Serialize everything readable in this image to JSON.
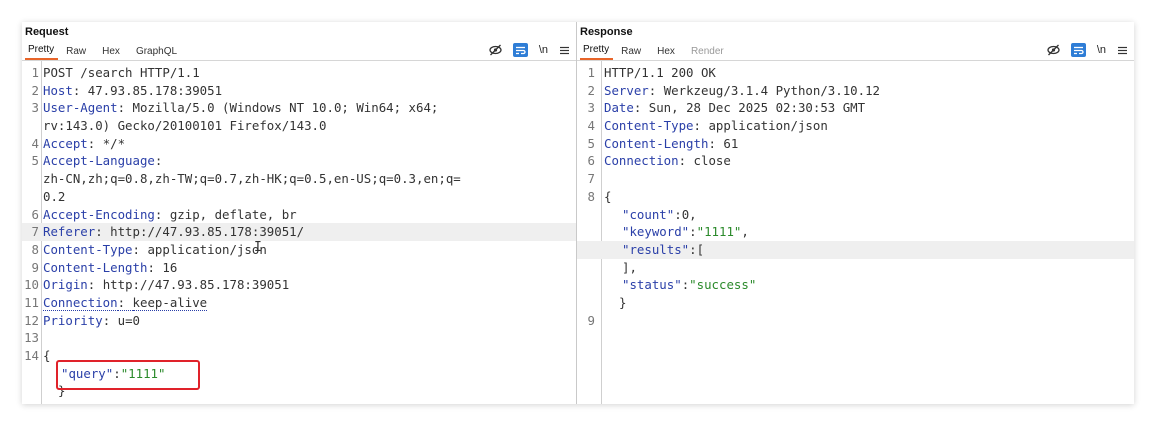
{
  "request": {
    "title": "Request",
    "tabs": [
      "Pretty",
      "Raw",
      "Hex",
      "GraphQL"
    ],
    "tools": {
      "hide_icon": "eye-slash-icon",
      "wrap_icon": "wrap-text-icon",
      "newline_label": "\\n",
      "menu_icon": "hamburger-menu-icon"
    },
    "lines": [
      {
        "n": "1",
        "name": "",
        "sep": "",
        "value": "POST /search HTTP/1.1"
      },
      {
        "n": "2",
        "name": "Host",
        "sep": ": ",
        "value": "47.93.85.178:39051"
      },
      {
        "n": "3",
        "name": "User-Agent",
        "sep": ": ",
        "value": "Mozilla/5.0 (Windows NT 10.0; Win64; x64;"
      },
      {
        "n": "",
        "name": "",
        "sep": "",
        "value": "rv:143.0) Gecko/20100101 Firefox/143.0"
      },
      {
        "n": "4",
        "name": "Accept",
        "sep": ": ",
        "value": "*/*"
      },
      {
        "n": "5",
        "name": "Accept-Language",
        "sep": ":",
        "value": ""
      },
      {
        "n": "",
        "name": "",
        "sep": "",
        "value": "zh-CN,zh;q=0.8,zh-TW;q=0.7,zh-HK;q=0.5,en-US;q=0.3,en;q="
      },
      {
        "n": "",
        "name": "",
        "sep": "",
        "value": "0.2"
      },
      {
        "n": "6",
        "name": "Accept-Encoding",
        "sep": ": ",
        "value": "gzip, deflate, br"
      },
      {
        "n": "7",
        "name": "Referer",
        "sep": ": ",
        "value": "http://47.93.85.178:39051/"
      },
      {
        "n": "8",
        "name": "Content-Type",
        "sep": ": ",
        "value": "application/json"
      },
      {
        "n": "9",
        "name": "Content-Length",
        "sep": ": ",
        "value": "16"
      },
      {
        "n": "10",
        "name": "Origin",
        "sep": ": ",
        "value": "http://47.93.85.178:39051"
      },
      {
        "n": "11",
        "name": "Connection",
        "sep": ": ",
        "value": "keep-alive"
      },
      {
        "n": "12",
        "name": "Priority",
        "sep": ": ",
        "value": "u=0"
      },
      {
        "n": "13",
        "name": "",
        "sep": "",
        "value": ""
      },
      {
        "n": "14",
        "name": "",
        "sep": "",
        "value": "{"
      }
    ],
    "body": {
      "query_key": "\"query\"",
      "colon": ":",
      "query_value": "\"1111\"",
      "close": "}"
    }
  },
  "response": {
    "title": "Response",
    "tabs": [
      "Pretty",
      "Raw",
      "Hex",
      "Render"
    ],
    "tools": {
      "hide_icon": "eye-slash-icon",
      "wrap_icon": "wrap-text-icon",
      "newline_label": "\\n",
      "menu_icon": "hamburger-menu-icon"
    },
    "lines": [
      {
        "n": "1",
        "name": "",
        "sep": "",
        "value": "HTTP/1.1 200 OK"
      },
      {
        "n": "2",
        "name": "Server",
        "sep": ": ",
        "value": "Werkzeug/3.1.4 Python/3.10.12"
      },
      {
        "n": "3",
        "name": "Date",
        "sep": ": ",
        "value": "Sun, 28 Dec 2025 02:30:53 GMT"
      },
      {
        "n": "4",
        "name": "Content-Type",
        "sep": ": ",
        "value": "application/json"
      },
      {
        "n": "5",
        "name": "Content-Length",
        "sep": ": ",
        "value": "61"
      },
      {
        "n": "6",
        "name": "Connection",
        "sep": ": ",
        "value": "close"
      },
      {
        "n": "7",
        "name": "",
        "sep": "",
        "value": ""
      },
      {
        "n": "8",
        "name": "",
        "sep": "",
        "value": "{"
      }
    ],
    "body": {
      "count_key": "\"count\"",
      "count_value": "0,",
      "keyword_key": "\"keyword\"",
      "keyword_value": "\"1111\"",
      "results_key": "\"results\"",
      "results_open": "[",
      "results_close": "],",
      "status_key": "\"status\"",
      "status_value": "\"success\"",
      "close": "}",
      "last_line": "9"
    }
  }
}
